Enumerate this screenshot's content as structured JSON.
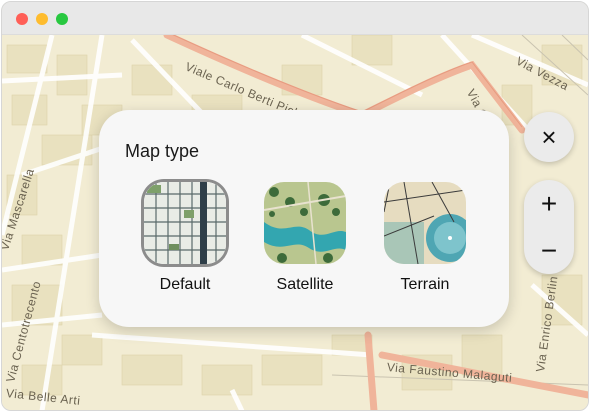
{
  "window": {
    "controls": [
      "close",
      "minimize",
      "maximize"
    ]
  },
  "map": {
    "streets": [
      "Viale Carlo Berti Pichat",
      "Via Ca",
      "Via Vezza",
      "Via Mascarella",
      "Via Centotrecento",
      "Via Faustino Malaguti",
      "Via Enrico Berlin",
      "Via Belle Arti"
    ]
  },
  "panel": {
    "title": "Map type",
    "options": [
      {
        "label": "Default",
        "selected": true
      },
      {
        "label": "Satellite",
        "selected": false
      },
      {
        "label": "Terrain",
        "selected": false
      }
    ]
  },
  "controls": {
    "close_icon": "×",
    "zoom_in": "+",
    "zoom_out": "−"
  },
  "colors": {
    "major_road": "#f0b49a",
    "land": "#f2ecd3",
    "panel": "#f7f7f7"
  }
}
